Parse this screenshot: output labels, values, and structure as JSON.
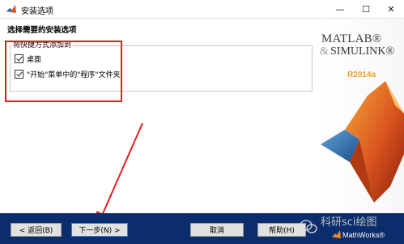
{
  "window": {
    "title": "安装选项",
    "min_glyph": "—",
    "max_glyph": "☐",
    "close_glyph": "✕"
  },
  "content": {
    "heading": "选择需要的安装选项",
    "group_label": "将快捷方式添加到",
    "options": [
      {
        "label": "桌面",
        "checked": true
      },
      {
        "label": "\"开始\"菜单中的\"程序\"文件夹",
        "checked": true
      }
    ]
  },
  "branding": {
    "matlab": "MATLAB®",
    "amp": "&",
    "simulink": "SIMULINK®",
    "version": "R2014a"
  },
  "buttons": {
    "back": "< 返回(B)",
    "next": "下一步(N) >",
    "cancel": "取消",
    "help": "帮助(H)"
  },
  "footer": {
    "watermark": "科研sci绘图",
    "mathworks": "MathWorks®"
  },
  "colors": {
    "accent_red": "#e02020",
    "bottom_bar": "#0c2d6b",
    "version_orange": "#e8a02a"
  }
}
